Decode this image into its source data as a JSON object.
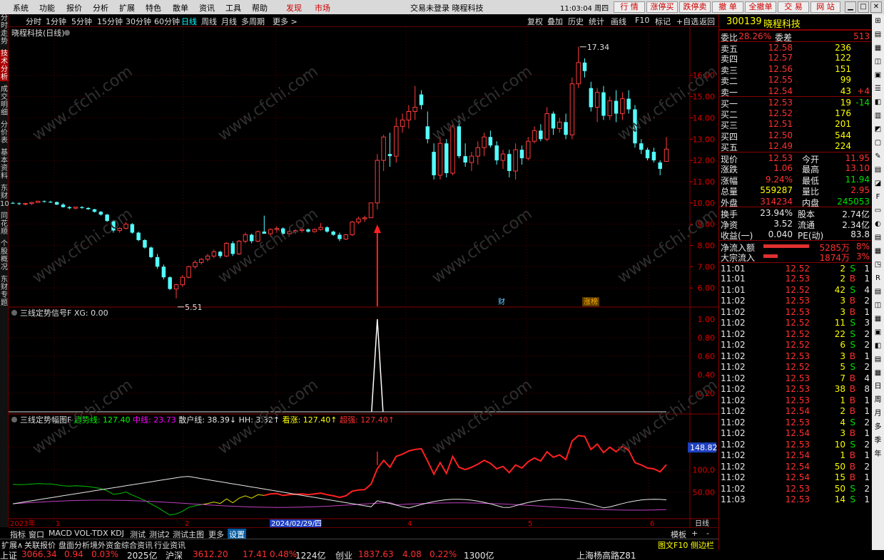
{
  "menubar": {
    "items": [
      "系统",
      "功能",
      "报价",
      "分析",
      "扩展",
      "特色",
      "散单",
      "资讯",
      "工具",
      "帮助"
    ],
    "find": "发现",
    "market": "市场",
    "title": "交易未登录  晓程科技",
    "clock": "11:03:04 周四",
    "buttons": [
      "行  情",
      "涨停买",
      "跌停卖",
      "撤  单",
      "全撤单",
      "交  易",
      "网  站"
    ]
  },
  "period_bar": {
    "items": [
      "分时",
      "1分钟",
      "5分钟",
      "15分钟",
      "30分钟",
      "60分钟",
      "日线",
      "周线",
      "月线",
      "多周期",
      "更多 >"
    ],
    "active": "日线",
    "right_items": [
      "复权",
      "叠加",
      "历史",
      "统计",
      "画线",
      "F10",
      "标记",
      "+自选",
      "返回"
    ]
  },
  "left_strip": [
    "分时走势",
    "技术分析",
    "成交明细",
    "分价表",
    "基本资料",
    "东财10",
    "同花顺",
    "个股概况",
    "东财专题"
  ],
  "chart_title": "晓程科技(日线)",
  "price_axis": [
    "16.00",
    "15.00",
    "14.00",
    "13.00",
    "12.00",
    "11.00",
    "10.00",
    "9.00",
    "8.00",
    "7.00",
    "6.00"
  ],
  "annotations": {
    "high": "17.34",
    "low": "5.51",
    "cai": "财",
    "zhang": "涨榜"
  },
  "indicator1": {
    "label": "三线定势信号F  XG: 0.00",
    "axis": [
      "1.00",
      "0.80",
      "0.60",
      "0.40",
      "0.20"
    ]
  },
  "indicator2": {
    "label_name": "三线定势幅图F",
    "series": [
      {
        "name": "趋势线",
        "value": "127.40",
        "color": "#00ff00"
      },
      {
        "name": "中线",
        "value": "23.73",
        "color": "#ff00ff"
      },
      {
        "name": "散户线",
        "value": "38.39",
        "arrow": "↓",
        "color": "#e8e8e8"
      },
      {
        "name": "HH",
        "value": "3.32",
        "arrow": "↑",
        "color": "#e8e8e8"
      },
      {
        "name": "看涨",
        "value": "127.40",
        "arrow": "↑",
        "color": "#ffff00"
      },
      {
        "name": "超强",
        "value": "127.40",
        "arrow": "↑",
        "color": "#ff3030"
      }
    ],
    "axis": [
      "150.0",
      "100.0",
      "50.00"
    ],
    "current_label": "148.82"
  },
  "x_axis": {
    "labels": [
      "2023年",
      "1",
      "2",
      "2024/02/29/四",
      "4",
      "5",
      "6"
    ],
    "right": "日线"
  },
  "bottom_tabs": {
    "items": [
      "指标",
      "窗口",
      "MACD",
      "VOL-TDX",
      "KDJ",
      "测试",
      "测试2",
      "测试主图",
      "更多",
      "设置"
    ],
    "active": "设置",
    "right": [
      "模板",
      "+",
      "-"
    ]
  },
  "bottom_tabs2": [
    "扩展∧",
    "关联报价",
    "盘面分析",
    "境外资金",
    "综合资讯",
    "行业资讯"
  ],
  "bottom_right": "图文F10 侧边栏",
  "stock": {
    "code": "300139",
    "name": "晓程科技"
  },
  "quote": {
    "weibi": "28.26%",
    "weicha": "513",
    "asks": [
      {
        "label": "卖五",
        "price": "12.58",
        "vol": "236"
      },
      {
        "label": "卖四",
        "price": "12.57",
        "vol": "122"
      },
      {
        "label": "卖三",
        "price": "12.56",
        "vol": "151"
      },
      {
        "label": "卖二",
        "price": "12.55",
        "vol": "99"
      },
      {
        "label": "卖一",
        "price": "12.54",
        "vol": "43",
        "chg": "+4"
      }
    ],
    "bids": [
      {
        "label": "买一",
        "price": "12.53",
        "vol": "19",
        "chg": "-14"
      },
      {
        "label": "买二",
        "price": "12.52",
        "vol": "176"
      },
      {
        "label": "买三",
        "price": "12.51",
        "vol": "201"
      },
      {
        "label": "买四",
        "price": "12.50",
        "vol": "544"
      },
      {
        "label": "买五",
        "price": "12.49",
        "vol": "224"
      }
    ],
    "stats": [
      [
        "现价",
        "12.53",
        "今开",
        "11.95"
      ],
      [
        "涨跌",
        "1.06",
        "最高",
        "13.10"
      ],
      [
        "涨幅",
        "9.24%",
        "最低",
        "11.94"
      ],
      [
        "总量",
        "559287",
        "量比",
        "2.95"
      ],
      [
        "外盘",
        "314234",
        "内盘",
        "245053"
      ]
    ],
    "stats2": [
      [
        "换手",
        "23.94%",
        "股本",
        "2.74亿"
      ],
      [
        "净资",
        "3.52",
        "流通",
        "2.34亿"
      ],
      [
        "收益(一)",
        "0.040",
        "PE(动)",
        "83.8"
      ]
    ],
    "flows": [
      {
        "label": "净流入额",
        "value": "5285万",
        "pct": "8%"
      },
      {
        "label": "大宗流入",
        "value": "1874万",
        "pct": "3%"
      }
    ]
  },
  "ticks": [
    [
      "11:01",
      "12.52",
      "2",
      "S",
      "1"
    ],
    [
      "11:01",
      "12.53",
      "2",
      "B",
      "1"
    ],
    [
      "11:01",
      "12.52",
      "42",
      "S",
      "4"
    ],
    [
      "11:02",
      "12.53",
      "3",
      "B",
      "2"
    ],
    [
      "11:02",
      "12.53",
      "3",
      "B",
      "1"
    ],
    [
      "11:02",
      "12.52",
      "11",
      "S",
      "3"
    ],
    [
      "11:02",
      "12.52",
      "22",
      "S",
      "2"
    ],
    [
      "11:02",
      "12.52",
      "6",
      "S",
      "2"
    ],
    [
      "11:02",
      "12.53",
      "3",
      "B",
      "1"
    ],
    [
      "11:02",
      "12.52",
      "5",
      "S",
      "2"
    ],
    [
      "11:02",
      "12.53",
      "7",
      "B",
      "4"
    ],
    [
      "11:02",
      "12.53",
      "38",
      "B",
      "8"
    ],
    [
      "11:02",
      "12.53",
      "1",
      "B",
      "1"
    ],
    [
      "11:02",
      "12.54",
      "2",
      "B",
      "1"
    ],
    [
      "11:02",
      "12.53",
      "4",
      "S",
      "2"
    ],
    [
      "11:02",
      "12.54",
      "3",
      "B",
      "1"
    ],
    [
      "11:02",
      "12.53",
      "10",
      "S",
      "2"
    ],
    [
      "11:02",
      "12.54",
      "1",
      "B",
      "1"
    ],
    [
      "11:02",
      "12.54",
      "50",
      "B",
      "2"
    ],
    [
      "11:02",
      "12.54",
      "15",
      "B",
      "1"
    ],
    [
      "11:02",
      "12.53",
      "50",
      "S",
      "2"
    ],
    [
      "11:03",
      "12.53",
      "14",
      "S",
      "1"
    ]
  ],
  "right_strip": [
    "日",
    "周",
    "月",
    "多",
    "季",
    "年"
  ],
  "status": {
    "sh_label": "上证",
    "sh_val": "3066.34",
    "sh_chg": "0.94",
    "sh_pct": "0.03%",
    "sh_amt": "2025亿",
    "sz_label": "沪深",
    "sz_val": "3612.20",
    "sz_chg": "17.41",
    "sz_pct": "0.48%",
    "sz_amt": "1224亿",
    "cy_label": "创业",
    "cy_val": "1837.63",
    "cy_chg": "4.08",
    "cy_pct": "0.22%",
    "cy_amt": "1300亿",
    "location": "上海杨高路Z81"
  },
  "watermark": "www.cfchi.com",
  "candles": [
    [
      10.0,
      10.05,
      9.95,
      9.98
    ],
    [
      9.98,
      10.02,
      9.9,
      9.95
    ],
    [
      9.95,
      10.0,
      9.88,
      9.97
    ],
    [
      9.97,
      10.05,
      9.9,
      10.02
    ],
    [
      10.02,
      10.1,
      10.0,
      10.08
    ],
    [
      10.08,
      10.12,
      10.02,
      10.05
    ],
    [
      10.05,
      10.1,
      10.0,
      10.04
    ],
    [
      10.04,
      10.06,
      9.9,
      9.92
    ],
    [
      9.92,
      9.98,
      9.78,
      9.8
    ],
    [
      9.8,
      9.85,
      9.7,
      9.75
    ],
    [
      9.75,
      9.82,
      9.7,
      9.8
    ],
    [
      9.8,
      9.85,
      9.72,
      9.76
    ],
    [
      9.76,
      9.8,
      9.68,
      9.7
    ],
    [
      9.7,
      9.72,
      9.55,
      9.58
    ],
    [
      9.58,
      9.62,
      9.4,
      9.45
    ],
    [
      9.45,
      9.48,
      9.1,
      9.15
    ],
    [
      9.15,
      9.2,
      8.6,
      8.7
    ],
    [
      8.7,
      8.85,
      8.6,
      8.8
    ],
    [
      8.8,
      9.1,
      8.75,
      9.0
    ],
    [
      9.0,
      9.05,
      8.55,
      8.6
    ],
    [
      8.6,
      8.65,
      8.2,
      8.25
    ],
    [
      8.25,
      8.3,
      7.85,
      7.9
    ],
    [
      7.9,
      7.95,
      7.4,
      7.45
    ],
    [
      7.45,
      7.6,
      6.9,
      7.0
    ],
    [
      7.0,
      7.1,
      6.4,
      6.5
    ],
    [
      6.5,
      6.55,
      5.9,
      5.95
    ],
    [
      5.95,
      6.2,
      5.51,
      6.15
    ],
    [
      6.15,
      6.6,
      6.05,
      6.5
    ],
    [
      6.5,
      7.05,
      6.45,
      7.0
    ],
    [
      7.0,
      7.3,
      6.9,
      7.2
    ],
    [
      7.2,
      7.4,
      7.1,
      7.35
    ],
    [
      7.35,
      7.6,
      7.25,
      7.5
    ],
    [
      7.5,
      7.8,
      7.4,
      7.7
    ],
    [
      7.7,
      7.75,
      7.4,
      7.5
    ],
    [
      7.5,
      8.15,
      7.45,
      8.1
    ],
    [
      8.1,
      8.2,
      7.5,
      7.6
    ],
    [
      7.6,
      8.25,
      7.55,
      8.2
    ],
    [
      8.2,
      8.6,
      8.1,
      8.5
    ],
    [
      8.5,
      8.55,
      8.1,
      8.2
    ],
    [
      8.2,
      8.7,
      8.15,
      8.65
    ],
    [
      8.65,
      9.4,
      8.6,
      8.55
    ],
    [
      8.55,
      8.8,
      8.4,
      8.75
    ],
    [
      8.75,
      8.9,
      8.6,
      8.8
    ],
    [
      8.8,
      8.85,
      8.5,
      8.55
    ],
    [
      8.55,
      8.7,
      8.5,
      8.65
    ],
    [
      8.65,
      8.75,
      8.55,
      8.7
    ],
    [
      8.7,
      8.8,
      8.6,
      8.75
    ],
    [
      8.75,
      8.8,
      8.6,
      8.65
    ],
    [
      8.65,
      8.8,
      8.6,
      8.75
    ],
    [
      8.75,
      9.05,
      8.7,
      8.85
    ],
    [
      8.85,
      8.9,
      8.6,
      8.65
    ],
    [
      8.65,
      8.7,
      8.45,
      8.5
    ],
    [
      8.5,
      8.6,
      8.2,
      8.3
    ],
    [
      8.3,
      8.55,
      8.25,
      8.5
    ],
    [
      8.5,
      9.15,
      8.45,
      9.1
    ],
    [
      9.1,
      9.35,
      9.0,
      9.25
    ],
    [
      9.25,
      9.4,
      9.1,
      9.3
    ],
    [
      9.3,
      10.0,
      9.7,
      10.0
    ],
    [
      10.0,
      12.3,
      9.7,
      12.0
    ],
    [
      12.0,
      13.2,
      11.5,
      13.1
    ],
    [
      12.3,
      13.3,
      11.7,
      12.2
    ],
    [
      12.2,
      14.0,
      11.9,
      13.6
    ],
    [
      13.6,
      14.2,
      13.3,
      13.9
    ],
    [
      13.9,
      14.6,
      13.5,
      14.3
    ],
    [
      14.3,
      15.5,
      13.9,
      14.5
    ],
    [
      15.1,
      15.3,
      14.4,
      14.6
    ],
    [
      13.6,
      14.3,
      12.8,
      13.0
    ],
    [
      12.4,
      12.8,
      11.1,
      11.3
    ],
    [
      11.3,
      13.1,
      11.1,
      12.8
    ],
    [
      12.8,
      13.0,
      11.2,
      11.4
    ],
    [
      11.4,
      13.8,
      11.3,
      13.6
    ],
    [
      13.6,
      14.1,
      12.1,
      12.2
    ],
    [
      12.2,
      12.8,
      11.7,
      11.9
    ],
    [
      11.9,
      12.4,
      11.5,
      12.2
    ],
    [
      12.2,
      12.9,
      11.8,
      12.6
    ],
    [
      12.6,
      13.3,
      12.2,
      13.1
    ],
    [
      13.1,
      13.4,
      12.6,
      12.7
    ],
    [
      12.7,
      12.9,
      11.8,
      12.0
    ],
    [
      12.0,
      12.5,
      11.6,
      12.3
    ],
    [
      12.3,
      12.5,
      11.2,
      11.5
    ],
    [
      11.5,
      12.8,
      11.1,
      12.5
    ],
    [
      12.5,
      12.7,
      11.8,
      12.1
    ],
    [
      12.1,
      13.1,
      12.0,
      12.9
    ],
    [
      12.9,
      13.6,
      12.8,
      13.4
    ],
    [
      13.4,
      13.7,
      12.9,
      13.0
    ],
    [
      13.0,
      14.5,
      12.9,
      14.2
    ],
    [
      14.2,
      14.3,
      13.2,
      13.5
    ],
    [
      13.5,
      14.0,
      13.3,
      13.8
    ],
    [
      13.8,
      14.2,
      13.0,
      13.2
    ],
    [
      13.2,
      15.9,
      13.0,
      15.6
    ],
    [
      15.6,
      17.34,
      15.4,
      16.6
    ],
    [
      16.6,
      16.8,
      15.9,
      16.2
    ],
    [
      15.4,
      15.7,
      14.3,
      14.5
    ],
    [
      14.5,
      15.4,
      13.8,
      15.2
    ],
    [
      15.2,
      15.5,
      13.9,
      14.1
    ],
    [
      14.1,
      15.0,
      13.9,
      14.8
    ],
    [
      14.8,
      15.3,
      13.8,
      14.2
    ],
    [
      14.2,
      15.2,
      13.9,
      14.9
    ],
    [
      14.9,
      15.3,
      14.2,
      14.4
    ],
    [
      14.4,
      14.6,
      12.6,
      12.8
    ],
    [
      12.8,
      13.0,
      12.3,
      12.5
    ],
    [
      12.5,
      12.6,
      12.0,
      12.1
    ],
    [
      12.4,
      12.6,
      11.9,
      12.0
    ],
    [
      11.9,
      12.0,
      11.3,
      11.6
    ],
    [
      11.95,
      13.1,
      11.94,
      12.53
    ]
  ],
  "xg_peak_index": 58
}
